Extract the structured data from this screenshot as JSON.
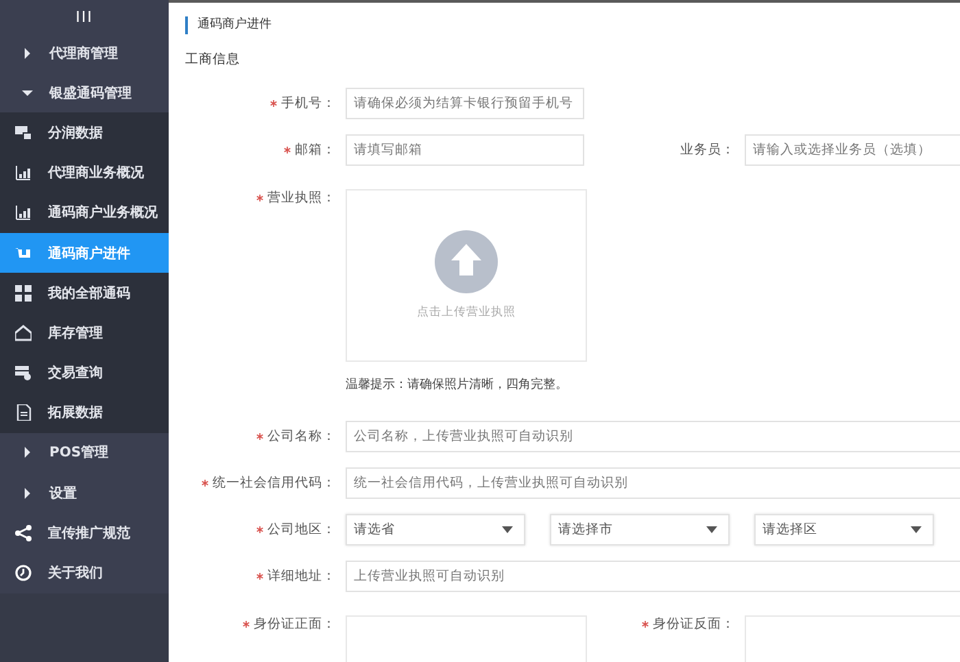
{
  "sidebar": {
    "toggle": "III",
    "items": [
      {
        "kind": "group",
        "label": "代理商管理",
        "expanded": false
      },
      {
        "kind": "group",
        "label": "银盛通码管理",
        "expanded": true,
        "children": [
          {
            "label": "分润数据",
            "selected": false
          },
          {
            "label": "代理商业务概况",
            "selected": false
          },
          {
            "label": "通码商户业务概况",
            "selected": false
          },
          {
            "label": "通码商户进件",
            "selected": true
          },
          {
            "label": "我的全部通码",
            "selected": false
          },
          {
            "label": "库存管理",
            "selected": false
          },
          {
            "label": "交易查询",
            "selected": false
          },
          {
            "label": "拓展数据",
            "selected": false
          }
        ]
      },
      {
        "kind": "group",
        "label": "POS管理",
        "expanded": false
      },
      {
        "kind": "group",
        "label": "设置",
        "expanded": false
      },
      {
        "kind": "link",
        "label": "宣传推广规范"
      },
      {
        "kind": "link",
        "label": "关于我们"
      }
    ]
  },
  "page": {
    "title": "通码商户进件",
    "section": "工商信息"
  },
  "form_rows": [
    {
      "fields": [
        {
          "kind": "text",
          "label": "手机号：",
          "required": true,
          "placeholder": "请确保必须为结算卡银行预留手机号"
        }
      ]
    },
    {
      "fields": [
        {
          "kind": "text",
          "label": "邮箱：",
          "required": true,
          "placeholder": "请填写邮箱"
        },
        {
          "kind": "text",
          "label": "业务员：",
          "required": false,
          "placeholder": "请输入或选择业务员（选填）"
        }
      ]
    },
    {
      "fields": [
        {
          "kind": "upload",
          "label": "营业执照：",
          "required": true,
          "prompt": "点击上传营业执照",
          "hint": "温馨提示：请确保照片清晰，四角完整。"
        }
      ]
    },
    {
      "fields": [
        {
          "kind": "wide",
          "label": "公司名称：",
          "required": true,
          "placeholder": "公司名称，上传营业执照可自动识别"
        }
      ]
    },
    {
      "fields": [
        {
          "kind": "wide",
          "label": "统一社会信用代码：",
          "required": true,
          "placeholder": "统一社会信用代码，上传营业执照可自动识别"
        }
      ]
    },
    {
      "fields": [
        {
          "kind": "selects",
          "label": "公司地区：",
          "required": true,
          "options": [
            "请选省",
            "请选择市",
            "请选择区"
          ]
        }
      ]
    },
    {
      "fields": [
        {
          "kind": "wide",
          "label": "详细地址：",
          "required": true,
          "placeholder": "上传营业执照可自动识别"
        }
      ]
    },
    {
      "fields": [
        {
          "kind": "upload",
          "label": "身份证正面：",
          "required": true
        },
        {
          "kind": "upload",
          "label": "身份证反面：",
          "required": true
        }
      ]
    }
  ]
}
